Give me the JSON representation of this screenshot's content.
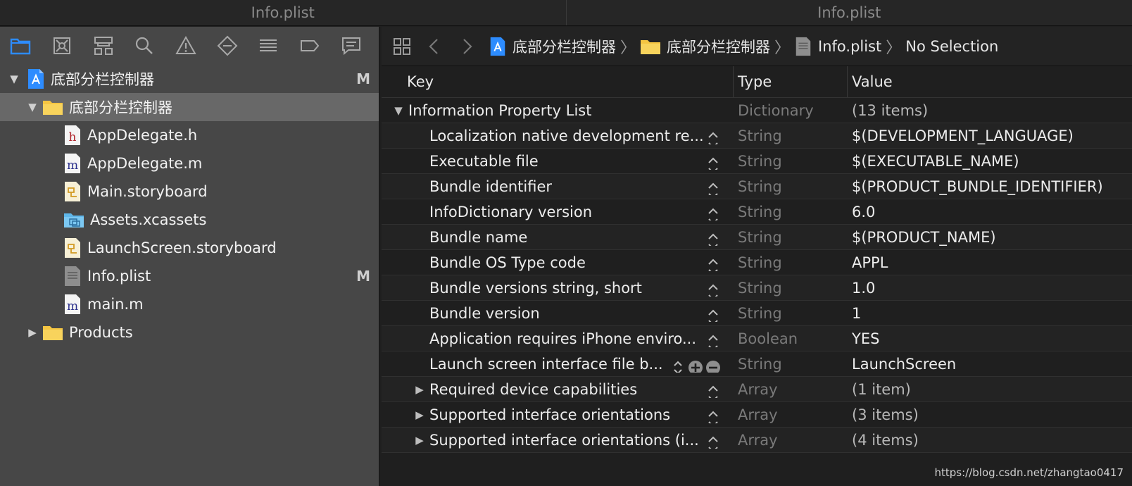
{
  "tabs": [
    "Info.plist",
    "Info.plist"
  ],
  "colors": {
    "accent": "#2d8cff",
    "folder": "#f5c542",
    "selected_row": "#686868"
  },
  "navigator": {
    "toolbar_icons": [
      "project-navigator-icon",
      "source-control-icon",
      "symbol-navigator-icon",
      "find-icon",
      "issue-icon",
      "test-icon",
      "debug-icon",
      "breakpoint-icon",
      "report-icon"
    ],
    "tree": [
      {
        "label": "底部分栏控制器",
        "kind": "project",
        "depth": 0,
        "badge": "M",
        "expanded": true
      },
      {
        "label": "底部分栏控制器",
        "kind": "folder",
        "depth": 1,
        "badge": "",
        "expanded": true,
        "selected": true
      },
      {
        "label": "AppDelegate.h",
        "kind": "h-file",
        "depth": 2,
        "badge": ""
      },
      {
        "label": "AppDelegate.m",
        "kind": "m-file",
        "depth": 2,
        "badge": ""
      },
      {
        "label": "Main.storyboard",
        "kind": "storyboard",
        "depth": 2,
        "badge": ""
      },
      {
        "label": "Assets.xcassets",
        "kind": "assets",
        "depth": 2,
        "badge": ""
      },
      {
        "label": "LaunchScreen.storyboard",
        "kind": "storyboard",
        "depth": 2,
        "badge": ""
      },
      {
        "label": "Info.plist",
        "kind": "plist",
        "depth": 2,
        "badge": "M"
      },
      {
        "label": "main.m",
        "kind": "m-file",
        "depth": 2,
        "badge": ""
      },
      {
        "label": "Products",
        "kind": "folder",
        "depth": 1,
        "badge": "",
        "expanded": false
      }
    ]
  },
  "jumpbar": {
    "crumbs": [
      "底部分栏控制器",
      "底部分栏控制器",
      "Info.plist",
      "No Selection"
    ]
  },
  "plist": {
    "headers": {
      "key": "Key",
      "type": "Type",
      "value": "Value"
    },
    "rows": [
      {
        "key": "Information Property List",
        "type": "Dictionary",
        "value": "(13 items)",
        "root": true,
        "disclosure": "open"
      },
      {
        "key": "Localization native development re...",
        "type": "String",
        "value": "$(DEVELOPMENT_LANGUAGE)"
      },
      {
        "key": "Executable file",
        "type": "String",
        "value": "$(EXECUTABLE_NAME)"
      },
      {
        "key": "Bundle identifier",
        "type": "String",
        "value": "$(PRODUCT_BUNDLE_IDENTIFIER)"
      },
      {
        "key": "InfoDictionary version",
        "type": "String",
        "value": "6.0"
      },
      {
        "key": "Bundle name",
        "type": "String",
        "value": "$(PRODUCT_NAME)"
      },
      {
        "key": "Bundle OS Type code",
        "type": "String",
        "value": "APPL"
      },
      {
        "key": "Bundle versions string, short",
        "type": "String",
        "value": "1.0"
      },
      {
        "key": "Bundle version",
        "type": "String",
        "value": "1"
      },
      {
        "key": "Application requires iPhone enviro...",
        "type": "Boolean",
        "value": "YES"
      },
      {
        "key": "Launch screen interface file b...",
        "type": "String",
        "value": "LaunchScreen",
        "hovered": true
      },
      {
        "key": "Required device capabilities",
        "type": "Array",
        "value": "(1 item)",
        "disclosure": "closed"
      },
      {
        "key": "Supported interface orientations",
        "type": "Array",
        "value": "(3 items)",
        "disclosure": "closed"
      },
      {
        "key": "Supported interface orientations (i...",
        "type": "Array",
        "value": "(4 items)",
        "disclosure": "closed"
      }
    ]
  },
  "watermark": "https://blog.csdn.net/zhangtao0417"
}
